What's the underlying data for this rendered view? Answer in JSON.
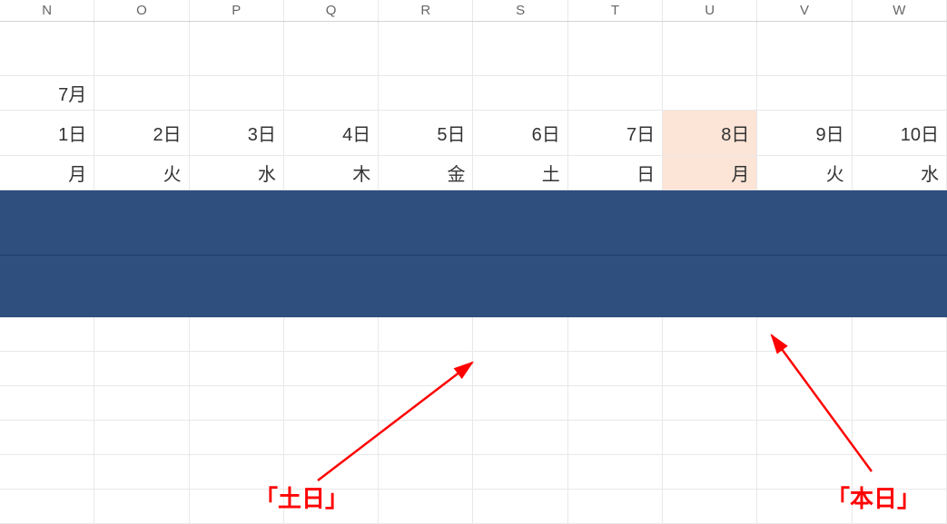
{
  "columns": [
    "N",
    "O",
    "P",
    "Q",
    "R",
    "S",
    "T",
    "U",
    "V",
    "W"
  ],
  "monthRow": [
    "7月",
    "",
    "",
    "",
    "",
    "",
    "",
    "",
    "",
    ""
  ],
  "dateRow": [
    "1日",
    "2日",
    "3日",
    "4日",
    "5日",
    "6日",
    "7日",
    "8日",
    "9日",
    "10日"
  ],
  "dayRow": [
    "月",
    "火",
    "水",
    "木",
    "金",
    "土",
    "日",
    "月",
    "火",
    "水"
  ],
  "todayIndex": 7,
  "weekendIndices": [
    5,
    6
  ],
  "annotations": {
    "weekend": "「土日」",
    "today": "「本日」"
  },
  "colors": {
    "navy": "#2f4f7f",
    "weekend": "#b3b3b3",
    "today": "#fce4d6",
    "arrow": "#ff0000"
  }
}
